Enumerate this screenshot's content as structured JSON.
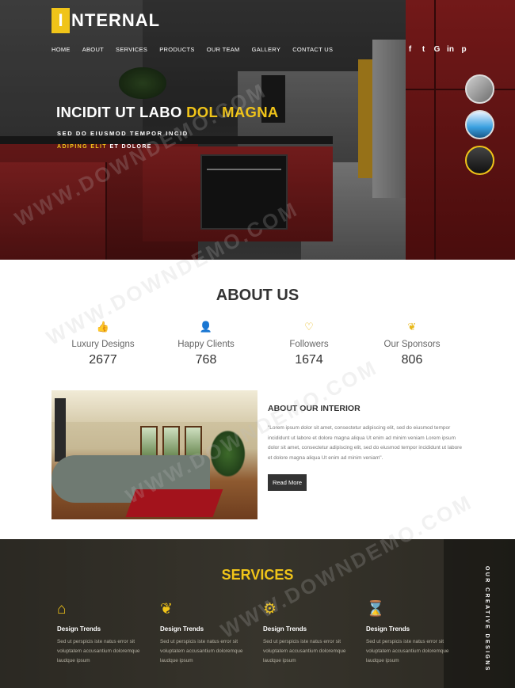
{
  "brand": {
    "letter": "I",
    "rest": "NTERNAL"
  },
  "nav": [
    {
      "label": "HOME"
    },
    {
      "label": "ABOUT"
    },
    {
      "label": "SERVICES"
    },
    {
      "label": "PRODUCTS"
    },
    {
      "label": "OUR TEAM"
    },
    {
      "label": "GALLERY"
    },
    {
      "label": "CONTACT US"
    }
  ],
  "social": [
    {
      "icon": "facebook-icon",
      "glyph": "f"
    },
    {
      "icon": "twitter-icon",
      "glyph": "t"
    },
    {
      "icon": "google-plus-icon",
      "glyph": "G"
    },
    {
      "icon": "linkedin-icon",
      "glyph": "in"
    },
    {
      "icon": "pinterest-icon",
      "glyph": "p"
    }
  ],
  "hero": {
    "title_main": "INCIDIT UT LABO ",
    "title_highlight": "DOL MAGNA",
    "subtitle": "SED DO EIUSMOD TEMPOR INCID",
    "subtitle2_highlight": "ADIPING ELIT",
    "subtitle2_rest": " ET DOLORE"
  },
  "about": {
    "title": "ABOUT US",
    "stats": [
      {
        "label": "Luxury Designs",
        "value": "2677",
        "icon": "thumbs-up-icon",
        "glyph": "👍"
      },
      {
        "label": "Happy Clients",
        "value": "768",
        "icon": "user-icon",
        "glyph": "👤"
      },
      {
        "label": "Followers",
        "value": "1674",
        "icon": "heart-icon",
        "glyph": "♡"
      },
      {
        "label": "Our Sponsors",
        "value": "806",
        "icon": "leaf-icon",
        "glyph": "❦"
      }
    ],
    "interior_title": "ABOUT OUR INTERIOR",
    "interior_text": "\"Lorem ipsum dolor sit amet, consectetur adipiscing elit, sed do eiusmod tempor incididunt ut labore et dolore magna aliqua Ut enim ad minim veniam Lorem ipsum dolor sit amet, consectetur adipiscing elit, sed do eiusmod tempor incididunt ut labore et dolore magna aliqua Ut enim ad minim veniam\".",
    "read_more": "Read More"
  },
  "services": {
    "title": "SERVICES",
    "side_text": "OUR CREATIVE DESIGNS",
    "items": [
      {
        "name": "Design Trends",
        "icon": "home-icon",
        "glyph": "⌂",
        "text": "Sed ut perspicis iste natus error sit voluptatem accusantium doloremque laudque ipsum"
      },
      {
        "name": "Design Trends",
        "icon": "leaf-icon",
        "glyph": "❦",
        "text": "Sed ut perspicis iste natus error sit voluptatem accusantium doloremque laudque ipsum"
      },
      {
        "name": "Design Trends",
        "icon": "gear-icon",
        "glyph": "⚙",
        "text": "Sed ut perspicis iste natus error sit voluptatem accusantium doloremque laudque ipsum"
      },
      {
        "name": "Design Trends",
        "icon": "hourglass-icon",
        "glyph": "⌛",
        "text": "Sed ut perspicis iste natus error sit voluptatem accusantium doloremque laudque ipsum"
      }
    ]
  },
  "watermark": "WWW.DOWNDEMO.COM",
  "colors": {
    "accent": "#f0c419",
    "dark": "#333333"
  }
}
